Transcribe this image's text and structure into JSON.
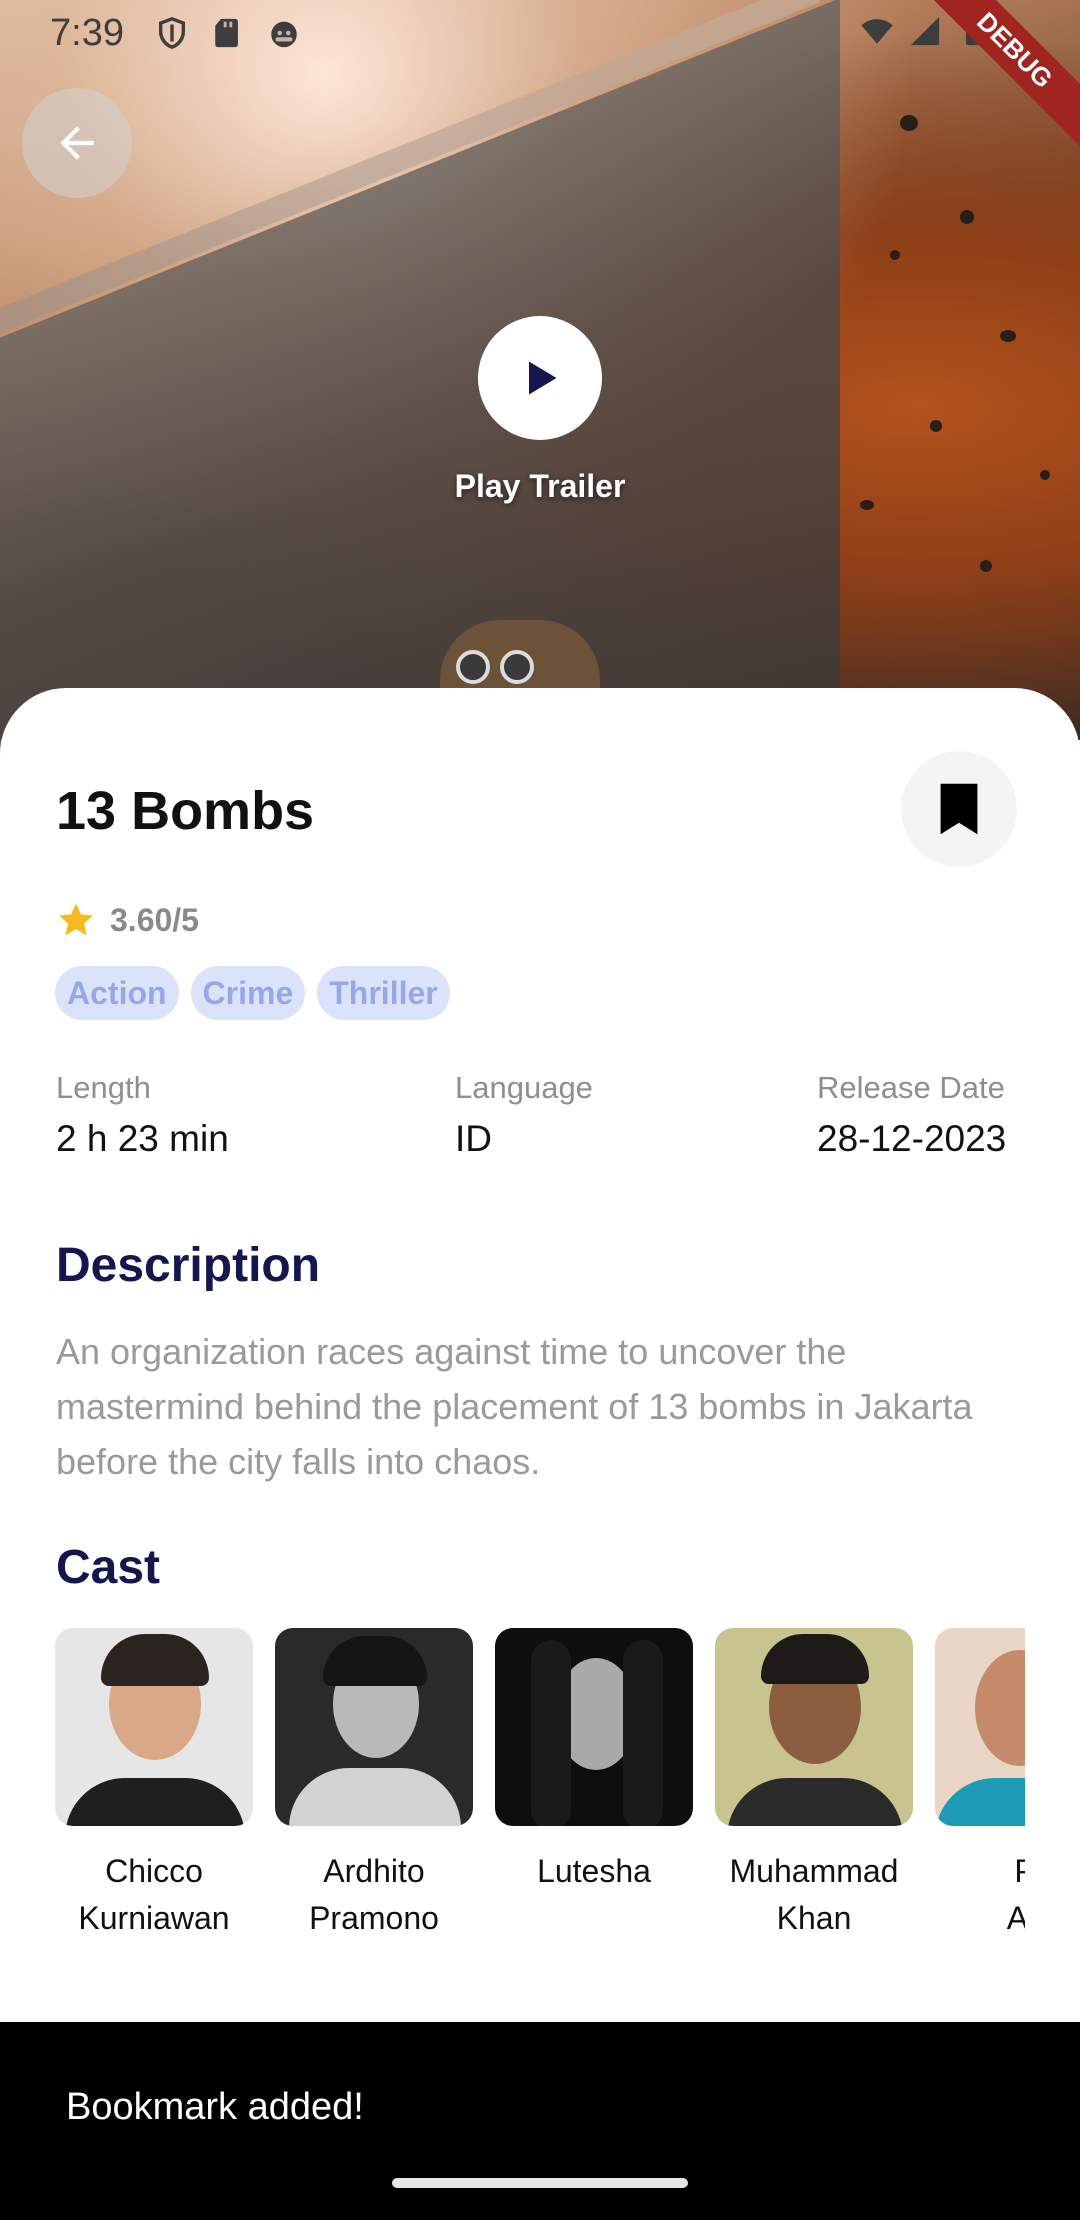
{
  "status_bar": {
    "time": "7:39",
    "debug_label": "DEBUG",
    "icons_left": [
      "shield-icon",
      "sd-card-icon",
      "android-face-icon"
    ],
    "icons_right": [
      "wifi-icon",
      "cell-signal-icon",
      "battery-icon"
    ]
  },
  "hero": {
    "play_label": "Play Trailer"
  },
  "movie": {
    "title": "13 Bombs",
    "rating": "3.60/5",
    "genres": [
      "Action",
      "Crime",
      "Thriller"
    ],
    "length_label": "Length",
    "length_value": "2 h 23 min",
    "language_label": "Language",
    "language_value": "ID",
    "release_label": "Release Date",
    "release_value": "28-12-2023",
    "description_title": "Description",
    "description": "An organization races against time to uncover the mastermind behind the placement of 13 bombs in Jakarta before the city falls into chaos.",
    "cast_title": "Cast",
    "cast": [
      {
        "line1": "Chicco",
        "line2": "Kurniawan"
      },
      {
        "line1": "Ardhito",
        "line2": "Pramono"
      },
      {
        "line1": "Lutesha",
        "line2": ""
      },
      {
        "line1": "Muhammad",
        "line2": "Khan"
      },
      {
        "line1": "Pu",
        "line2": "Ayu"
      }
    ]
  },
  "snackbar": {
    "message": "Bookmark added!"
  },
  "colors": {
    "accent": "#14164e",
    "chip_bg": "#dbe3fb",
    "chip_text": "#97a8e8",
    "star": "#f6b91f",
    "snackbar_bg": "#000000"
  }
}
